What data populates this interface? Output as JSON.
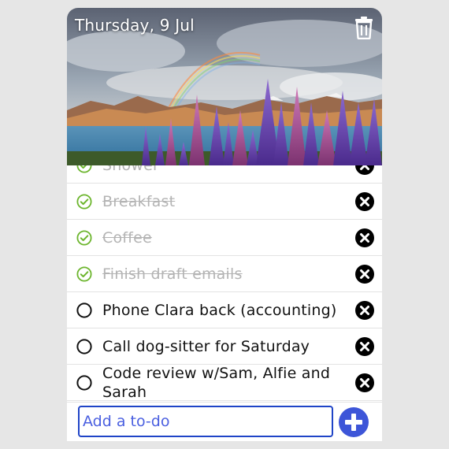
{
  "header": {
    "date": "Thursday, 9 Jul",
    "trash_icon": "trash-icon"
  },
  "todos": [
    {
      "text": "Shower",
      "done": true
    },
    {
      "text": "Breakfast",
      "done": true
    },
    {
      "text": "Coffee",
      "done": true
    },
    {
      "text": "Finish draft emails",
      "done": true
    },
    {
      "text": "Phone Clara back (accounting)",
      "done": false
    },
    {
      "text": "Call dog-sitter for Saturday",
      "done": false
    },
    {
      "text": "Code review w/Sam, Alfie and Sarah",
      "done": false
    }
  ],
  "footer": {
    "placeholder": "Add a to-do",
    "add_icon": "plus-circle-icon"
  },
  "colors": {
    "done_check": "#6cb52d",
    "open_check": "#111111",
    "accent": "#3d55d8",
    "done_text": "#b4b4b4"
  }
}
